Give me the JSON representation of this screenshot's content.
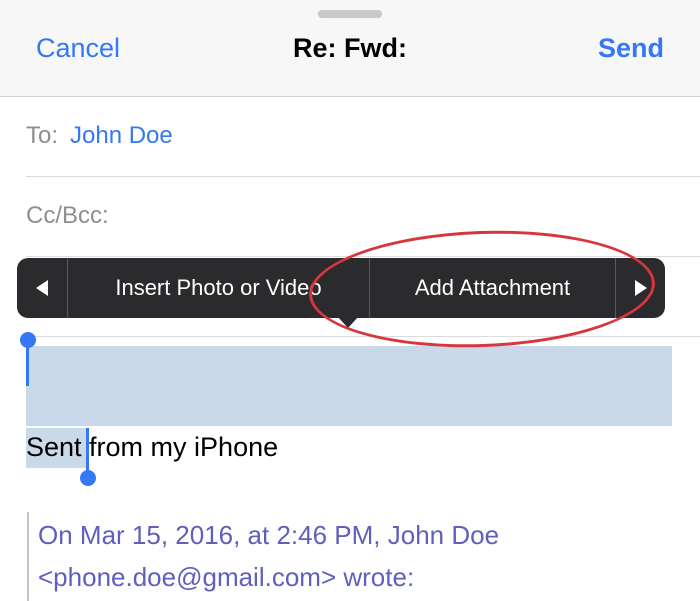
{
  "header": {
    "cancel_label": "Cancel",
    "title": "Re: Fwd:",
    "send_label": "Send"
  },
  "fields": {
    "to_label": "To:",
    "to_value": "John Doe",
    "cc_label": "Cc/Bcc:"
  },
  "popover_menu": {
    "items": [
      {
        "label": "Insert Photo or Video"
      },
      {
        "label": "Add Attachment"
      }
    ],
    "left_arrow_icon": "left-triangle-icon",
    "right_arrow_icon": "right-triangle-icon"
  },
  "body": {
    "selected_word": "Sent",
    "signature_rest": " from my iPhone",
    "quote_line1": "On Mar 15, 2016, at 2:46 PM, John Doe",
    "quote_line2": "<phone.doe@gmail.com> wrote:"
  },
  "colors": {
    "accent": "#3478f6",
    "popover_bg": "#2b2b2d",
    "selection": "#cad9ea",
    "annotation": "#d7363d",
    "quote_text": "#5f5fbd"
  }
}
